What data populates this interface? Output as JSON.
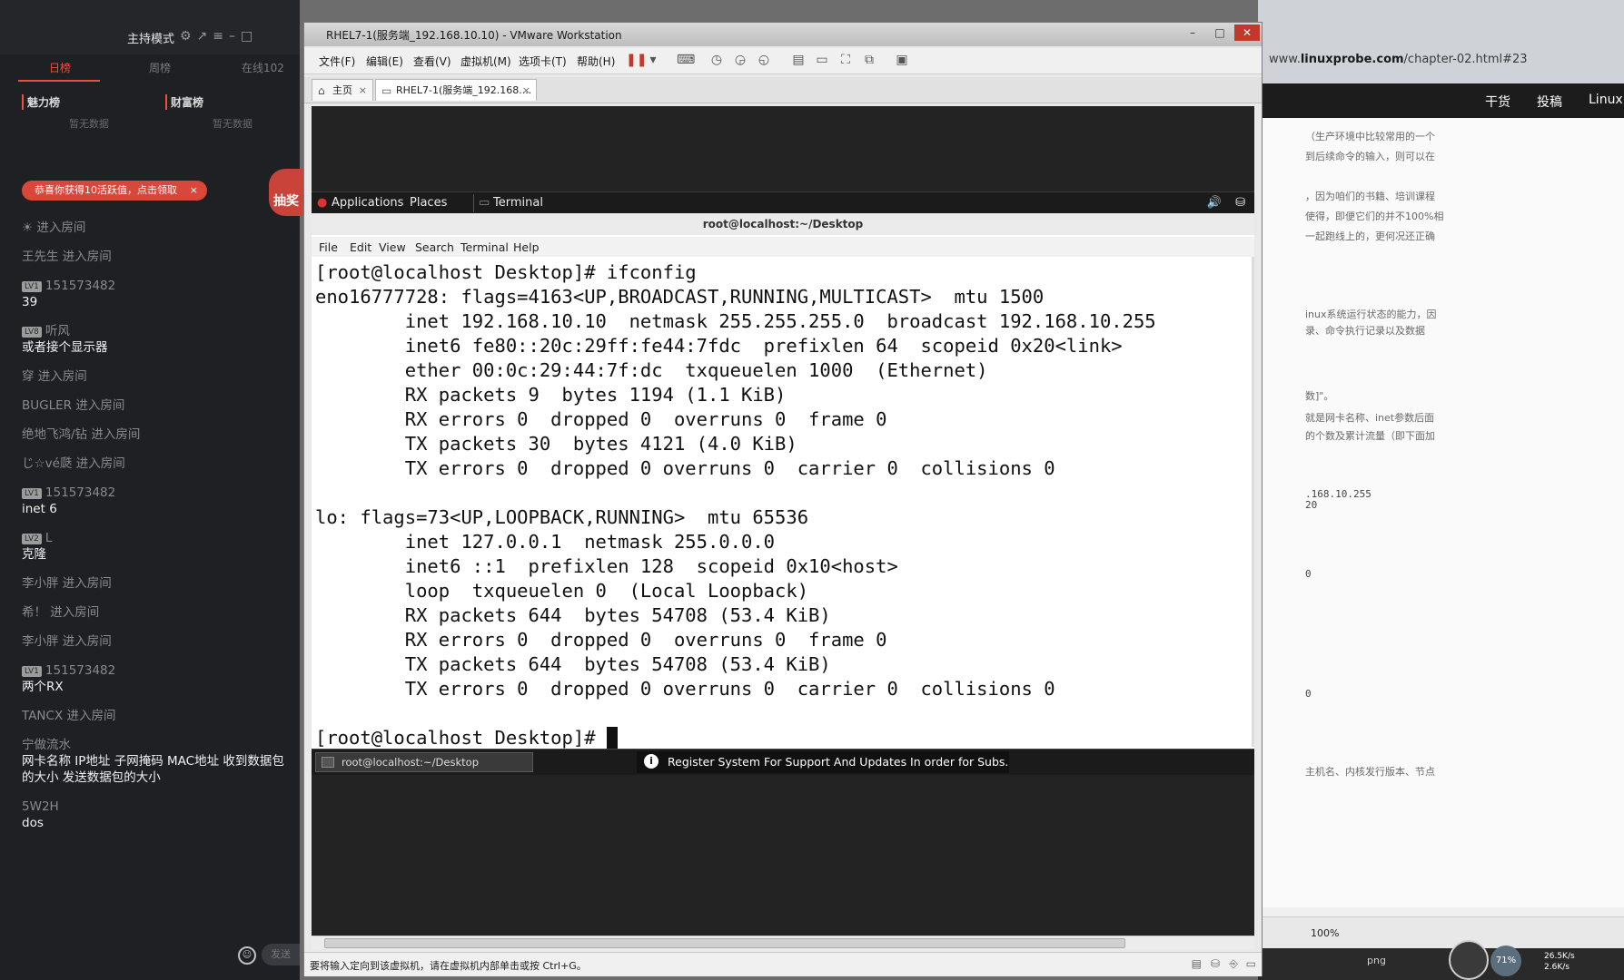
{
  "stream_panel": {
    "mode_label": "主持模式",
    "tabs": [
      "日榜",
      "周榜",
      "在线102"
    ],
    "ranks": [
      {
        "label": "魅力榜",
        "empty": "暂无数据"
      },
      {
        "label": "财富榜",
        "empty": "暂无数据"
      }
    ],
    "notice": "恭喜你获得10活跃值，点击领取",
    "notice_close": "×",
    "lottery": "抽奖",
    "chat": [
      {
        "user": "☀",
        "text": "",
        "enter": "进入房间"
      },
      {
        "user": "王先生",
        "text": "",
        "enter": "进入房间"
      },
      {
        "level": "LV1",
        "user": "151573482",
        "text": "39"
      },
      {
        "level": "LV8",
        "user": "听风",
        "text": "或者接个显示器"
      },
      {
        "user": "穿",
        "text": "",
        "enter": "进入房间"
      },
      {
        "user": "BUGLER",
        "text": "",
        "enter": "进入房间"
      },
      {
        "user": "绝地飞鸿/钻",
        "text": "",
        "enter": "进入房间"
      },
      {
        "user": "じ☆vé瓞",
        "text": "",
        "enter": "进入房间"
      },
      {
        "level": "LV1",
        "user": "151573482",
        "text": "inet 6"
      },
      {
        "level": "LV2",
        "user": "L",
        "text": "克隆"
      },
      {
        "user": "李小胖",
        "text": "",
        "enter": "进入房间"
      },
      {
        "user": "希！",
        "text": "",
        "enter": "进入房间"
      },
      {
        "user": "李小胖",
        "text": "",
        "enter": "进入房间"
      },
      {
        "level": "LV1",
        "user": "151573482",
        "text": "两个RX"
      },
      {
        "user": "TANCX",
        "text": "",
        "enter": "进入房间"
      },
      {
        "user": "宁做流水",
        "text": "网卡名称 IP地址 子网掩码 MAC地址 收到数据包的大小 发送数据包的大小"
      },
      {
        "user": "5W2H",
        "text": "dos"
      }
    ],
    "send_label": "发送"
  },
  "browser": {
    "url_prefix": "www.",
    "url_domain": "linuxprobe.com",
    "url_suffix": "/chapter-02.html#23",
    "nav": [
      "干货",
      "投稿",
      "Linux"
    ],
    "lines": [
      {
        "text": "（生产环境中比较常用的一个",
        "mono": false
      },
      {
        "text": "到后续命令的输入，则可以在",
        "mono": false
      },
      {
        "text": "，因为咱们的书籍、培训课程",
        "mono": false
      },
      {
        "text": "使得，即便它们的并不100%相",
        "mono": false
      },
      {
        "text": "一起跑线上的，更何况还正确",
        "mono": false
      },
      {
        "text": "inux系统运行状态的能力，因",
        "mono": false
      },
      {
        "text": "录、命令执行记录以及数据",
        "mono": false
      },
      {
        "text": "数]\"。",
        "mono": false
      },
      {
        "text": "就是网卡名称、inet参数后面",
        "mono": false
      },
      {
        "text": "的个数及累计流量（即下面加",
        "mono": false
      },
      {
        "text": ".168.10.255",
        "mono": true
      },
      {
        "text": "20",
        "mono": true
      },
      {
        "text": "0",
        "mono": true
      },
      {
        "text": "0",
        "mono": true
      },
      {
        "text": "主机名、内核发行版本、节点",
        "mono": false
      }
    ],
    "zoom": "100%",
    "png_label": "png",
    "net_up": "26.5K/s",
    "net_down": "2.6K/s",
    "cpu": "71%"
  },
  "vmware": {
    "title": "RHEL7-1(服务端_192.168.10.10) - VMware Workstation",
    "window_controls": [
      "–",
      "□",
      "✕"
    ],
    "menus": [
      "文件(F)",
      "编辑(E)",
      "查看(V)",
      "虚拟机(M)",
      "选项卡(T)",
      "帮助(H)"
    ],
    "tabs": [
      {
        "label": "主页",
        "close": "×"
      },
      {
        "label": "RHEL7-1(服务端_192.168....",
        "close": "×"
      }
    ],
    "statusbar": "要将输入定向到该虚拟机，请在虚拟机内部单击或按 Ctrl+G。",
    "accent": "#c0392b"
  },
  "gnome": {
    "applications": "Applications",
    "places": "Places",
    "terminal": "Terminal",
    "task": "root@localhost:~/Desktop",
    "notification": "Register System For Support And Updates  In order for Subs..."
  },
  "terminal": {
    "title": "root@localhost:~/Desktop",
    "menus": [
      "File",
      "Edit",
      "View",
      "Search",
      "Terminal",
      "Help"
    ],
    "lines": [
      "[root@localhost Desktop]# ifconfig",
      "eno16777728: flags=4163<UP,BROADCAST,RUNNING,MULTICAST>  mtu 1500",
      "        inet 192.168.10.10  netmask 255.255.255.0  broadcast 192.168.10.255",
      "        inet6 fe80::20c:29ff:fe44:7fdc  prefixlen 64  scopeid 0x20<link>",
      "        ether 00:0c:29:44:7f:dc  txqueuelen 1000  (Ethernet)",
      "        RX packets 9  bytes 1194 (1.1 KiB)",
      "        RX errors 0  dropped 0  overruns 0  frame 0",
      "        TX packets 30  bytes 4121 (4.0 KiB)",
      "        TX errors 0  dropped 0 overruns 0  carrier 0  collisions 0",
      "",
      "lo: flags=73<UP,LOOPBACK,RUNNING>  mtu 65536",
      "        inet 127.0.0.1  netmask 255.0.0.0",
      "        inet6 ::1  prefixlen 128  scopeid 0x10<host>",
      "        loop  txqueuelen 0  (Local Loopback)",
      "        RX packets 644  bytes 54708 (53.4 KiB)",
      "        RX errors 0  dropped 0  overruns 0  frame 0",
      "        TX packets 644  bytes 54708 (53.4 KiB)",
      "        TX errors 0  dropped 0 overruns 0  carrier 0  collisions 0",
      ""
    ],
    "prompt": "[root@localhost Desktop]# "
  }
}
